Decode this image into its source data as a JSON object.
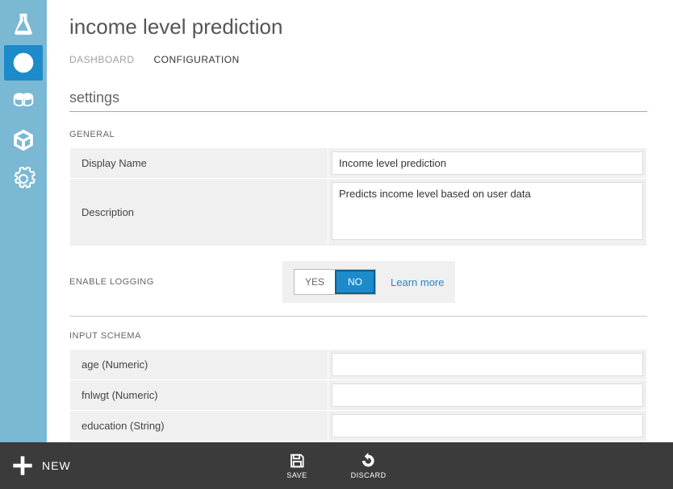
{
  "header": {
    "title": "income level prediction"
  },
  "tabs": {
    "dashboard": "DASHBOARD",
    "configuration": "CONFIGURATION"
  },
  "settings": {
    "heading": "settings",
    "general_label": "GENERAL",
    "display_name_label": "Display Name",
    "display_name_value": "Income level prediction",
    "description_label": "Description",
    "description_value": "Predicts income level based on user data",
    "enable_logging_label": "ENABLE LOGGING",
    "toggle_yes": "YES",
    "toggle_no": "NO",
    "learn_more": "Learn more",
    "input_schema_label": "INPUT SCHEMA",
    "schema": [
      {
        "label": "age (Numeric)",
        "value": ""
      },
      {
        "label": "fnlwgt (Numeric)",
        "value": ""
      },
      {
        "label": "education (String)",
        "value": ""
      }
    ]
  },
  "bottombar": {
    "new": "NEW",
    "save": "SAVE",
    "discard": "DISCARD"
  }
}
